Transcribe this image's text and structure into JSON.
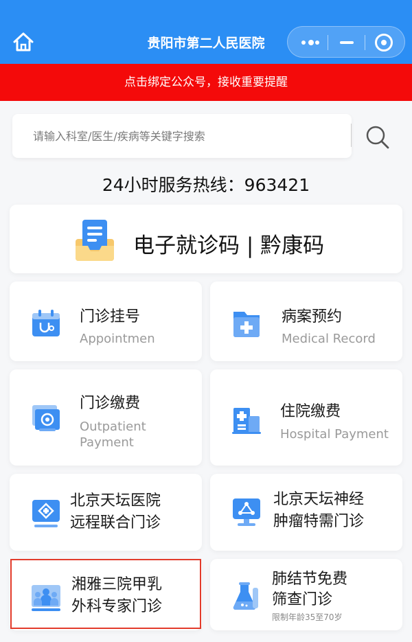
{
  "header": {
    "title": "贵阳市第二人民医院"
  },
  "notice": {
    "text": "点击绑定公众号，接收重要提醒"
  },
  "search": {
    "placeholder": "请输入科室/医生/疾病等关键字搜索",
    "value": ""
  },
  "hotline": {
    "text": "24小时服务热线：963421"
  },
  "code_card": {
    "label": "电子就诊码 | 黔康码"
  },
  "tiles": [
    {
      "zh": "门诊挂号",
      "en": "Appointmen",
      "icon": "calendar-stethoscope-icon"
    },
    {
      "zh": "病案预约",
      "en": "Medical Record",
      "icon": "medical-folder-icon"
    },
    {
      "zh": "门诊缴费",
      "en_line1": "Outpatient",
      "en_line2": "Payment",
      "icon": "payment-card-icon"
    },
    {
      "zh": "住院缴费",
      "en": "Hospital Payment",
      "icon": "hospital-building-icon"
    },
    {
      "zh_line1": "北京天坛医院",
      "zh_line2": "远程联合门诊",
      "icon": "remote-clinic-icon"
    },
    {
      "zh_line1": "北京天坛神经",
      "zh_line2": "肿瘤特需门诊",
      "icon": "monitor-network-icon"
    },
    {
      "zh_line1": "湘雅三院甲乳",
      "zh_line2": "外科专家门诊",
      "icon": "doctors-group-icon"
    },
    {
      "zh_line1": "肺结节免费",
      "zh_line2": "筛查门诊",
      "note": "限制年龄35至70岁",
      "icon": "lab-flask-icon"
    }
  ],
  "colors": {
    "brand_blue": "#2b8ef4",
    "notice_red": "#f40a0a",
    "icon_blue": "#3d8ff2",
    "highlight": "#e23a2a"
  }
}
